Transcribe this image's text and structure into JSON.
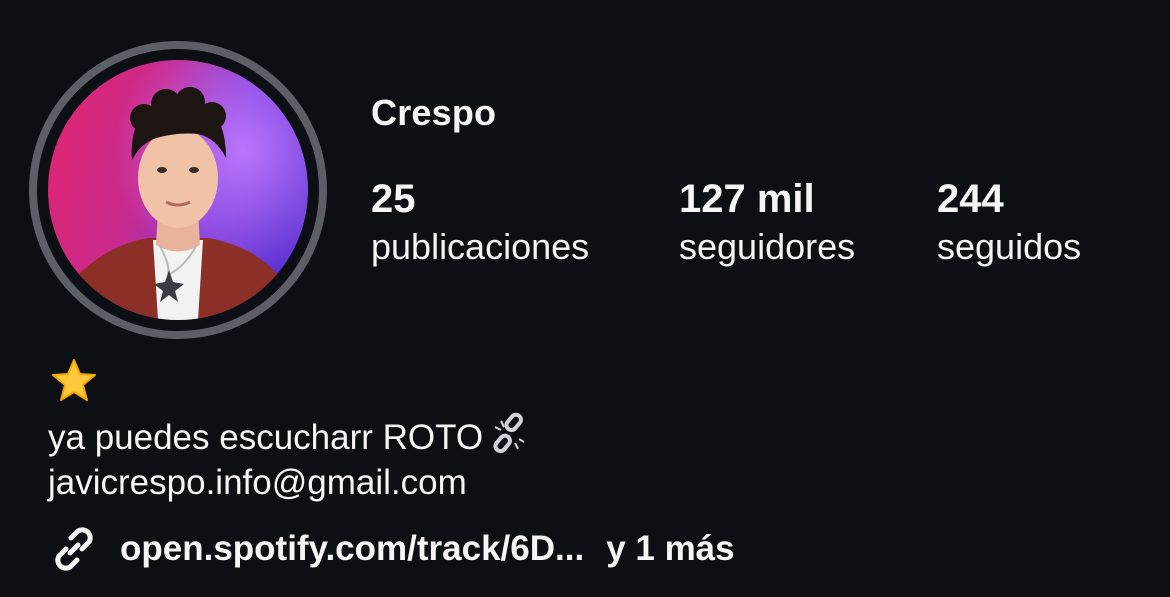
{
  "profile": {
    "username": "Crespo",
    "stats": {
      "posts_value": "25",
      "posts_label": "publicaciones",
      "followers_value": "127 mil",
      "followers_label": "seguidores",
      "following_value": "244",
      "following_label": "seguidos"
    },
    "bio": {
      "emoji_icon": "star-emoji-icon",
      "line1": "ya puedes escucharr ROTO",
      "line1_icon": "broken-chain-emoji-icon",
      "line2": "javicrespo.info@gmail.com"
    },
    "link": {
      "icon": "link-icon",
      "text": "open.spotify.com/track/6D...",
      "more": "y 1 más"
    }
  },
  "colors": {
    "background": "#0c1014",
    "text": "#f5f5f5",
    "avatar_ring": "#5c5f66"
  }
}
